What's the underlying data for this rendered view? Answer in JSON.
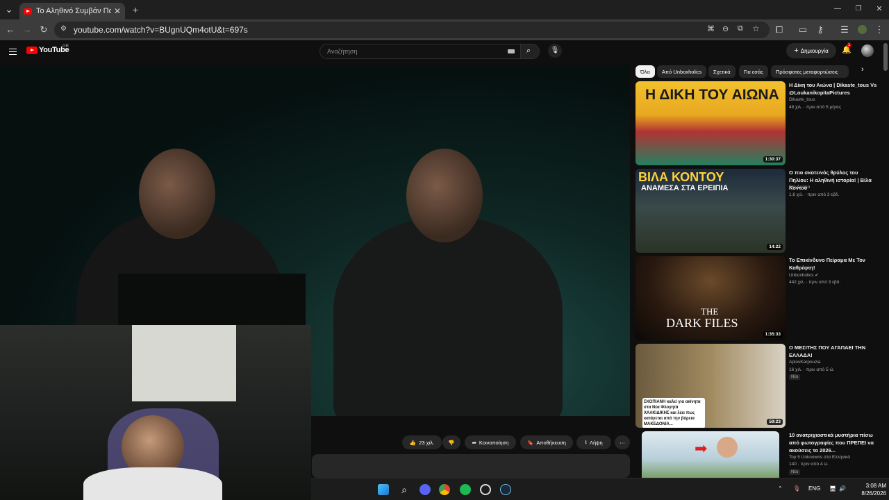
{
  "browser": {
    "tab_title": "Το Αληθινό Συμβάν Που Ζήσαμ",
    "url": "youtube.com/watch?v=BUgnUQm4otU&t=697s"
  },
  "youtube": {
    "logo_text": "YouTube",
    "region": "GR",
    "search_placeholder": "Αναζήτηση",
    "create_label": "Δημιουργία",
    "notification_count": "1"
  },
  "actions": {
    "like_count": "23 χιλ.",
    "share": "Κοινοποίηση",
    "save": "Αποθήκευση",
    "download": "Λήψη"
  },
  "chips": [
    "Όλα",
    "Από Unboxholics",
    "Σχετικά",
    "Για εσάς",
    "Πρόσφατες μεταφορτώσεις"
  ],
  "recommendations": [
    {
      "title": "Η Δίκη του Αιώνα | Dikaste_tous Vs @LoukanikopitaPictures",
      "channel": "Dikaste_tous",
      "meta": "48 χιλ. · πριν από 5 μήνες",
      "duration": "1:30:37",
      "thumb_text": "Η ΔΙΚΗ ΤΟΥ ΑΙΩΝΑ",
      "new": ""
    },
    {
      "title": "Ο πιο σκοτεινός θρύλος του Πηλίου: Η αληθινή ιστορία! | Βίλα Κοντού",
      "channel": "Στο Δρόμο",
      "meta": "1,6 χιλ. · πριν από 3 εβδ.",
      "duration": "14:22",
      "thumb_text": "ΒΙΛΑ ΚΟΝΤΟΥ",
      "thumb_sub": "ΑΝΑΜΕΣΑ ΣΤΑ ΕΡΕΙΠΙΑ",
      "new": ""
    },
    {
      "title": "Το Επικίνδυνο Πείραμα Με Τον Καθρέφτη!",
      "channel": "Unboxholics",
      "meta": "442 χιλ. · πριν από 3 εβδ.",
      "duration": "1:35:33",
      "thumb_text": "THE",
      "thumb_sub": "DARK FILES",
      "new": ""
    },
    {
      "title": "Ο ΜΕΣΙΤΗΣ ΠΟΥ ΑΓΑΠΑΕΙ ΤΗΝ ΕΛΛΑΔΑ!",
      "channel": "AplosKarpouzia",
      "meta": "16 χιλ. · πριν από 5 ώ.",
      "duration": "59:23",
      "thumb_text": "ΣΚΟΠΙΑΝΗ καλεί για ακίνητα στα Νέα Φλογητά ΧΑΛΚΙΔΙΚΗΣ και λέει πως κατάγεται από την βόρεια ΜΑΚΕΔΟΝΙΑ...",
      "new": "Νέο"
    },
    {
      "title": "10 ανατριχιαστικά μυστήρια πίσω από φωτογραφίες που ΠΡΕΠΕΙ να ακούσεις το 2026...",
      "channel": "Top 5 Unknowns στα Ελληνικά",
      "meta": "140 · πριν από 4 ώ.",
      "duration": "",
      "new": "Νέο"
    }
  ],
  "taskbar": {
    "lang": "ENG",
    "time": "3:08 AM",
    "date": "8/26/2026"
  },
  "colors": {
    "brand": "#ff0000",
    "background": "#0f0f0f",
    "chip": "#272727"
  }
}
